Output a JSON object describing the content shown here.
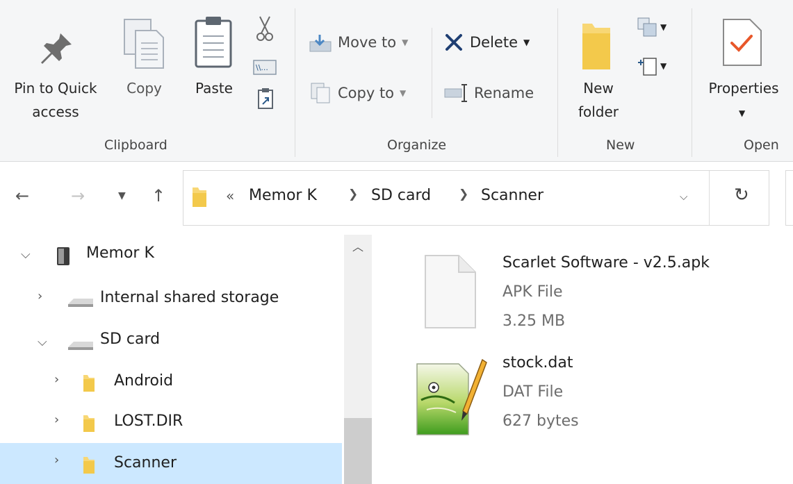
{
  "ribbon": {
    "clipboard": {
      "group_label": "Clipboard",
      "pin_label_1": "Pin to Quick",
      "pin_label_2": "access",
      "copy_label": "Copy",
      "paste_label": "Paste"
    },
    "organize": {
      "group_label": "Organize",
      "move_to": "Move to",
      "copy_to": "Copy to",
      "delete": "Delete",
      "rename": "Rename"
    },
    "new": {
      "group_label": "New",
      "new_folder_1": "New",
      "new_folder_2": "folder"
    },
    "open": {
      "group_label": "Open",
      "properties": "Properties"
    }
  },
  "address": {
    "overflow": "«",
    "crumbs": [
      "Memor K",
      "SD card",
      "Scanner"
    ]
  },
  "nav": {
    "items": [
      {
        "label": "Memor K"
      },
      {
        "label": "Internal shared storage"
      },
      {
        "label": "SD card"
      },
      {
        "label": "Android"
      },
      {
        "label": "LOST.DIR"
      },
      {
        "label": "Scanner"
      }
    ]
  },
  "files": [
    {
      "name": "Scarlet Software - v2.5.apk",
      "type": "APK File",
      "size": "3.25 MB",
      "icon": "generic-file-icon"
    },
    {
      "name": "stock.dat",
      "type": "DAT File",
      "size": "627 bytes",
      "icon": "notepad-plus-plus-icon"
    }
  ],
  "colors": {
    "accent_check": "#e8572a",
    "selection": "#cce8ff",
    "delete_x": "#1f3f73",
    "folder": "#f8d775"
  }
}
